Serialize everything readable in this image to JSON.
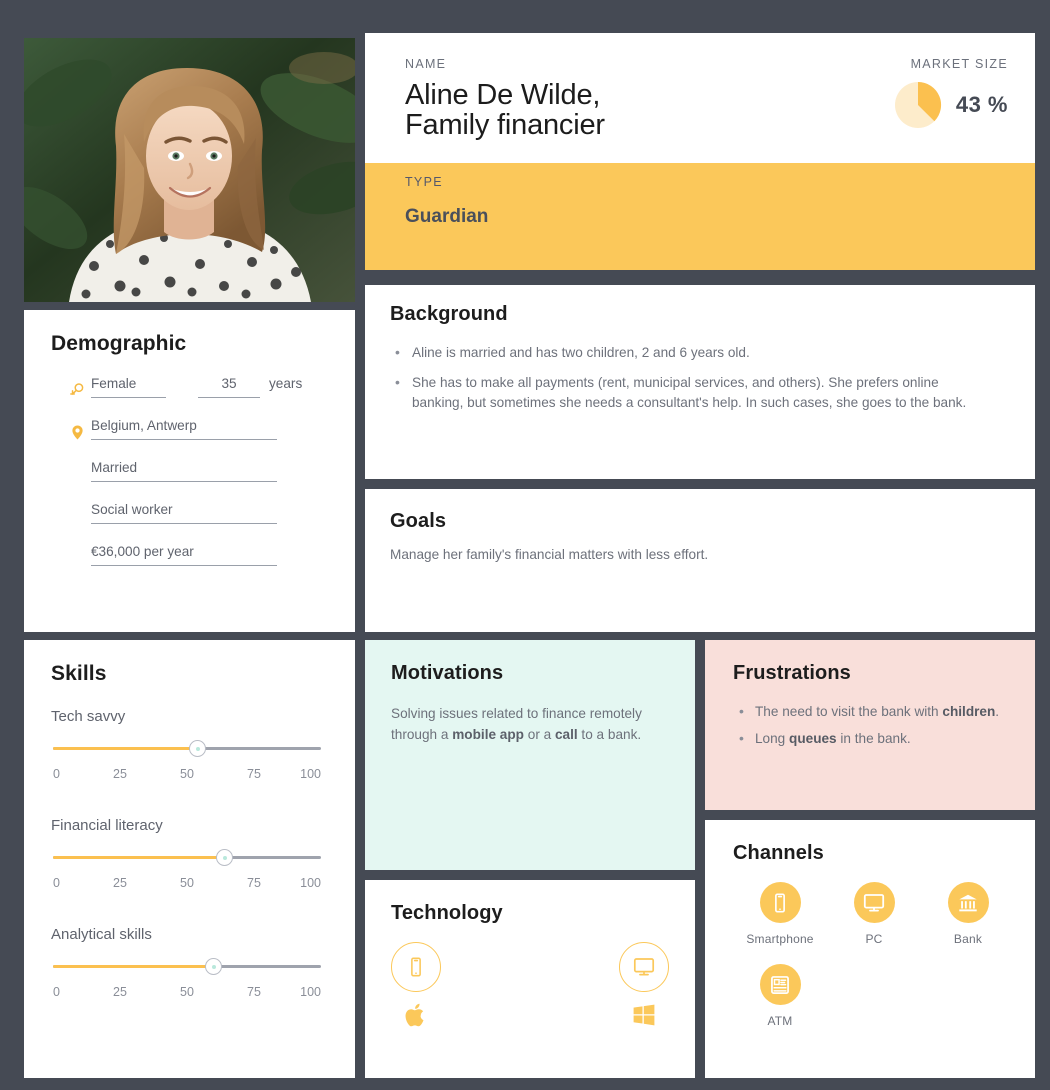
{
  "theme": {
    "background": "#454a54",
    "accent_yellow": "#fbc85a",
    "accent_yellow_soft": "#fbc04f",
    "motivations_bg": "#e4f7f2",
    "frustrations_bg": "#f9dfda",
    "text_muted": "#6d717b"
  },
  "photo": {
    "alt": "portrait-photo-of-smiling-woman-with-long-blonde-hair-in-white-polka-dot-blouse-against-green-tropical-leaves"
  },
  "header": {
    "name_kicker": "NAME",
    "name": "Aline De Wilde,\n Family financier",
    "market_kicker": "MARKET SIZE",
    "market_value": "43 %"
  },
  "type": {
    "kicker": "TYPE",
    "value": "Guardian"
  },
  "demographic": {
    "title": "Demographic",
    "gender": "Female",
    "age": "35",
    "age_unit": "years",
    "location": "Belgium, Antwerp",
    "marital_status": "Married",
    "occupation": "Social worker",
    "income": "€36,000 per year",
    "gender_icon": "female-symbol-icon",
    "location_icon": "map-pin-icon"
  },
  "background": {
    "title": "Background",
    "items": [
      "Aline is married and has two children, 2 and 6 years old.",
      "She has to make all payments (rent, municipal services, and others). She prefers online banking, but sometimes she needs a consultant's help. In such cases, she goes to the bank."
    ]
  },
  "goals": {
    "title": "Goals",
    "text": "Manage her family's financial matters with less effort."
  },
  "skills": {
    "title": "Skills",
    "items": [
      {
        "label": "Tech savvy",
        "value": 54
      },
      {
        "label": "Financial literacy",
        "value": 64
      },
      {
        "label": "Analytical skills",
        "value": 60
      }
    ],
    "ticks": [
      "0",
      "25",
      "50",
      "75",
      "100"
    ]
  },
  "motivations": {
    "title": "Motivations",
    "text_parts": [
      {
        "t": "Solving issues related to finance remotely through a ",
        "b": false
      },
      {
        "t": "mobile app",
        "b": true
      },
      {
        "t": " or a ",
        "b": false
      },
      {
        "t": "call",
        "b": true
      },
      {
        "t": " to a bank.",
        "b": false
      }
    ]
  },
  "technology": {
    "title": "Technology",
    "items": [
      {
        "device": "Smartphone",
        "device_icon": "smartphone-icon",
        "os_icon": "apple-logo-icon"
      },
      {
        "device": "Desktop",
        "device_icon": "monitor-icon",
        "os_icon": "windows-logo-icon"
      }
    ]
  },
  "frustrations": {
    "title": "Frustrations",
    "items": [
      [
        {
          "t": "The need to visit the bank with ",
          "b": false
        },
        {
          "t": "children",
          "b": true
        },
        {
          "t": ".",
          "b": false
        }
      ],
      [
        {
          "t": "Long ",
          "b": false
        },
        {
          "t": "queues",
          "b": true
        },
        {
          "t": " in the bank.",
          "b": false
        }
      ]
    ]
  },
  "channels": {
    "title": "Channels",
    "items": [
      {
        "label": "Smartphone",
        "icon": "smartphone-icon"
      },
      {
        "label": "PC",
        "icon": "monitor-icon"
      },
      {
        "label": "Bank",
        "icon": "bank-building-icon"
      },
      {
        "label": "ATM",
        "icon": "atm-machine-icon"
      }
    ]
  },
  "chart_data": {
    "type": "pie",
    "title": "MARKET SIZE",
    "categories": [
      "Market share",
      "Remainder"
    ],
    "values": [
      43,
      57
    ],
    "colors": [
      "#fbc04f",
      "#fdeccb"
    ],
    "label": "43 %",
    "start_angle_deg": 0,
    "legend": "none"
  }
}
